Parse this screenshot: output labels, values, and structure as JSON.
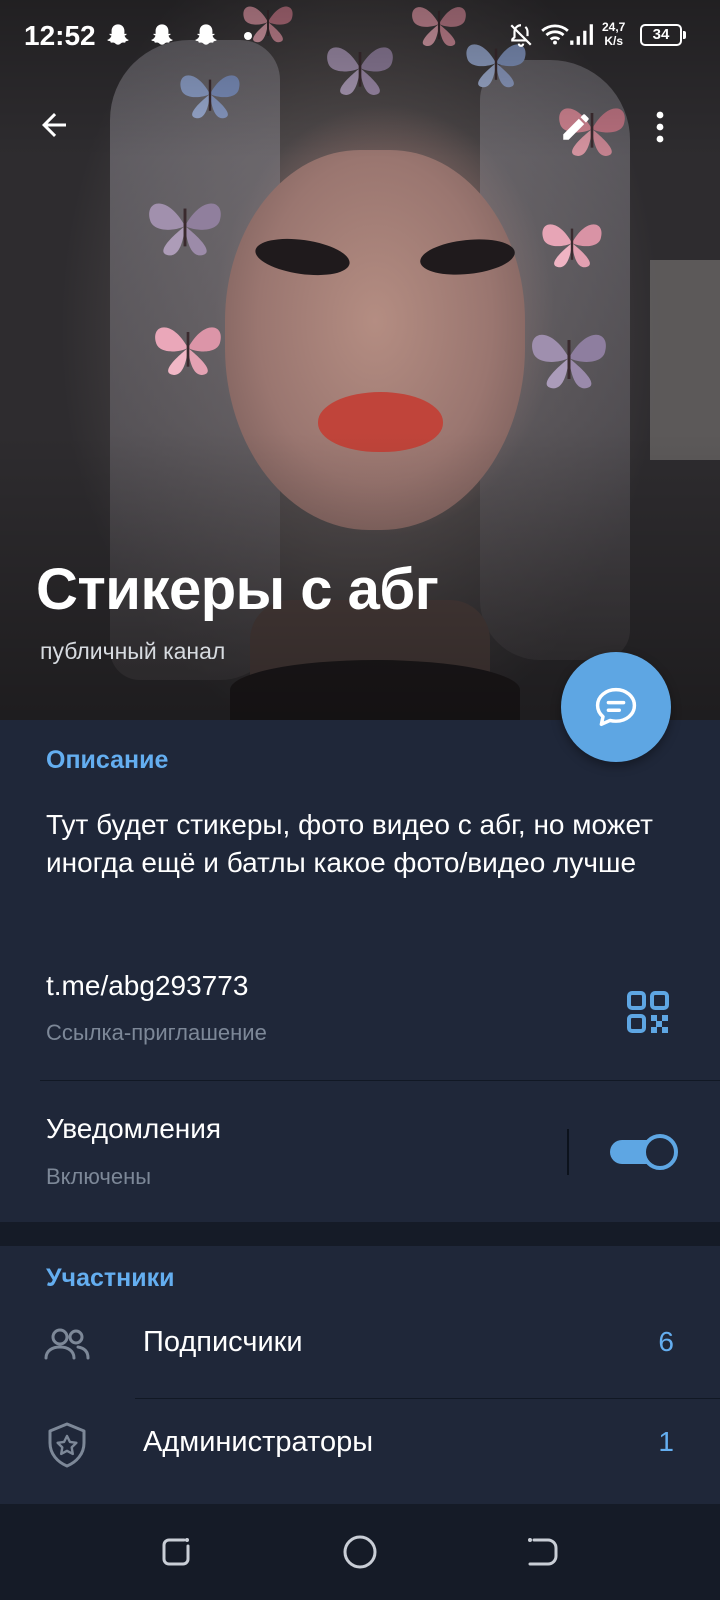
{
  "status_bar": {
    "time": "12:52",
    "net_speed_value": "24,7",
    "net_speed_unit": "K/s",
    "battery": "34"
  },
  "header": {
    "title": "Стикеры с абг",
    "subtitle": "публичный канал"
  },
  "info": {
    "section_title": "Описание",
    "description": "Тут будет стикеры, фото видео с абг, но может иногда ещё и батлы какое фото/видео лучше",
    "link": "t.me/abg293773",
    "link_caption": "Ссылка-приглашение",
    "notifications_label": "Уведомления",
    "notifications_state": "Включены",
    "notifications_enabled": true
  },
  "members": {
    "section_title": "Участники",
    "rows": [
      {
        "label": "Подписчики",
        "count": "6",
        "icon": "people-icon"
      },
      {
        "label": "Администраторы",
        "count": "1",
        "icon": "shield-star-icon"
      }
    ]
  },
  "colors": {
    "accent": "#5ea6e3",
    "link_blue": "#64aef0",
    "card_bg": "#1f2739",
    "gap_bg": "#151b27"
  }
}
